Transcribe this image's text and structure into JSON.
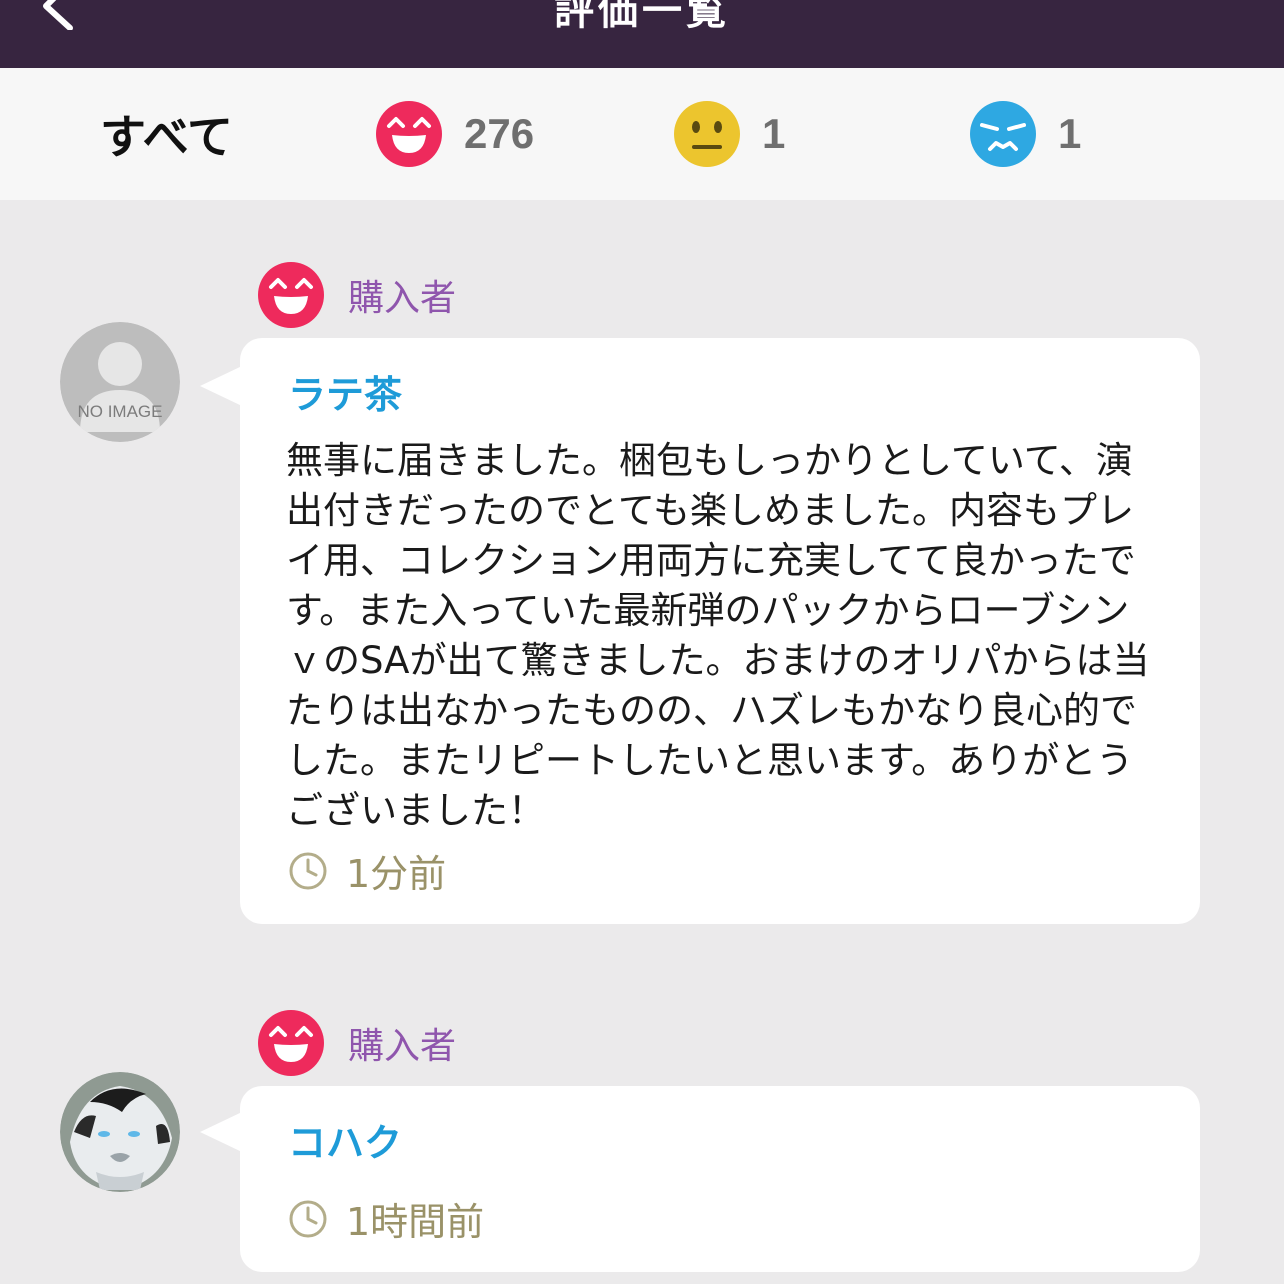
{
  "header": {
    "title": "評価一覧",
    "back_icon": "chevron-left-icon",
    "background": "#372540"
  },
  "tabs": [
    {
      "label": "すべて"
    },
    {
      "icon": "smile-face-icon",
      "count": "276",
      "color": "#ee2a5c"
    },
    {
      "icon": "neutral-face-icon",
      "count": "1",
      "color": "#ecc52e"
    },
    {
      "icon": "sad-face-icon",
      "count": "1",
      "color": "#2ea8e2"
    }
  ],
  "reviews": [
    {
      "rating_icon": "smile-face-icon",
      "role": "購入者",
      "avatar": "no-image-avatar",
      "avatar_text": "NO IMAGE",
      "name": "ラテ茶",
      "comment": "無事に届きました。梱包もしっかりとしていて、演出付きだったのでとても楽しめました。内容もプレイ用、コレクション用両方に充実してて良かったです。また入っていた最新弾のパックからローブシンｖのSAが出て驚きました。おまけのオリパからは当たりは出なかったものの、ハズレもかなり良心的でした。またリピートしたいと思います。ありがとうございました！",
      "time_icon": "clock-icon",
      "time": "1分前"
    },
    {
      "rating_icon": "smile-face-icon",
      "role": "購入者",
      "avatar": "wolf-avatar",
      "name": "コハク",
      "comment": "",
      "time_icon": "clock-icon",
      "time": "1時間前"
    }
  ],
  "colors": {
    "accent_name": "#1e9bd8",
    "role_label": "#8f56ad",
    "time_text": "#9a9268",
    "page_bg": "#ebeaeb"
  }
}
